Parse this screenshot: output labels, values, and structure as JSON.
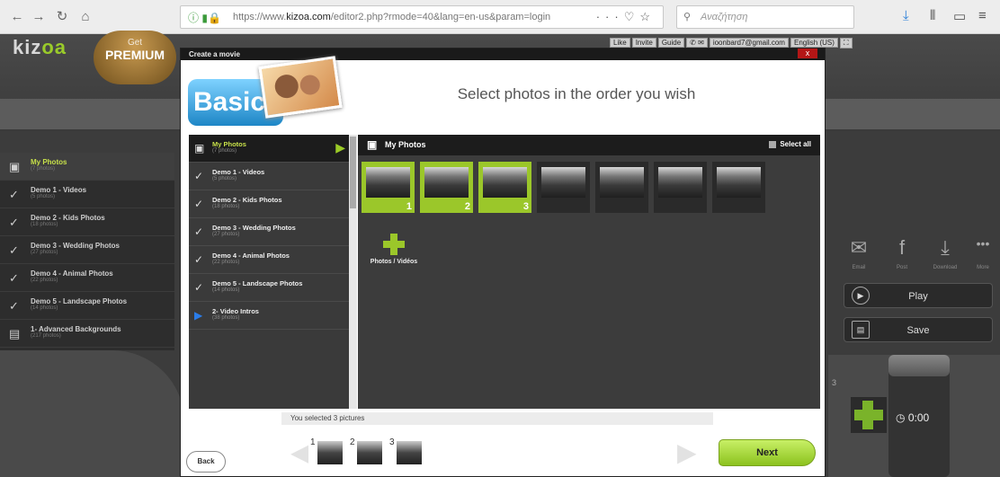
{
  "browser": {
    "url_prefix": "https://www.",
    "url_domain": "kizoa.com",
    "url_rest": "/editor2.php?rmode=40&lang=en-us&param=login",
    "url_tools": "···♡☆",
    "search_placeholder": "Αναζήτηση"
  },
  "app": {
    "logo_a": "kiz",
    "logo_b": "oa",
    "premium_get": "Get",
    "premium_label": "PREMIUM",
    "top_links": [
      "Like",
      "Invite",
      "Guide",
      "",
      "ioonbard7@gmail.com",
      "English (US)"
    ],
    "sidebar": [
      {
        "title": "My Photos",
        "sub": "(7 photos)",
        "selected": true
      },
      {
        "title": "Demo 1 - Videos",
        "sub": "(5 photos)"
      },
      {
        "title": "Demo 2 - Kids Photos",
        "sub": "(18 photos)"
      },
      {
        "title": "Demo 3 - Wedding Photos",
        "sub": "(27 photos)"
      },
      {
        "title": "Demo 4 - Animal Photos",
        "sub": "(22 photos)"
      },
      {
        "title": "Demo 5 - Landscape Photos",
        "sub": "(14 photos)"
      },
      {
        "title": "1- Advanced Backgrounds",
        "sub": "(217 photos)"
      }
    ],
    "share": [
      {
        "label": "Email",
        "icon": "envelope-icon"
      },
      {
        "label": "Post",
        "icon": "facebook-icon"
      },
      {
        "label": "Download",
        "icon": "download-icon"
      },
      {
        "label": "More",
        "icon": "more-icon"
      }
    ],
    "play_label": "Play",
    "save_label": "Save",
    "timer": "0:00",
    "slot_number": "3"
  },
  "modal": {
    "title": "Create a movie",
    "close": "x",
    "logo": "Basic",
    "heading": "Select photos in the order you wish",
    "folders": [
      {
        "title": "My Photos",
        "sub": "(7 photos)",
        "selected": true
      },
      {
        "title": "Demo 1 - Videos",
        "sub": "(5 photos)"
      },
      {
        "title": "Demo 2 - Kids Photos",
        "sub": "(18 photos)"
      },
      {
        "title": "Demo 3 - Wedding Photos",
        "sub": "(27 photos)"
      },
      {
        "title": "Demo 4 - Animal Photos",
        "sub": "(22 photos)"
      },
      {
        "title": "Demo 5 - Landscape Photos",
        "sub": "(14 photos)"
      },
      {
        "title": "2- Video Intros",
        "sub": "(38 photos)"
      }
    ],
    "pane_title": "My Photos",
    "select_all": "Select all",
    "photos": [
      {
        "selected": true,
        "num": "1"
      },
      {
        "selected": true,
        "num": "2"
      },
      {
        "selected": true,
        "num": "3"
      },
      {
        "selected": false,
        "num": ""
      },
      {
        "selected": false,
        "num": ""
      },
      {
        "selected": false,
        "num": ""
      },
      {
        "selected": false,
        "num": ""
      }
    ],
    "add_label": "Photos / Vidéos",
    "selected_text": "You selected 3 pictures",
    "strip": [
      "1",
      "2",
      "3"
    ],
    "back": "Back",
    "next": "Next"
  }
}
